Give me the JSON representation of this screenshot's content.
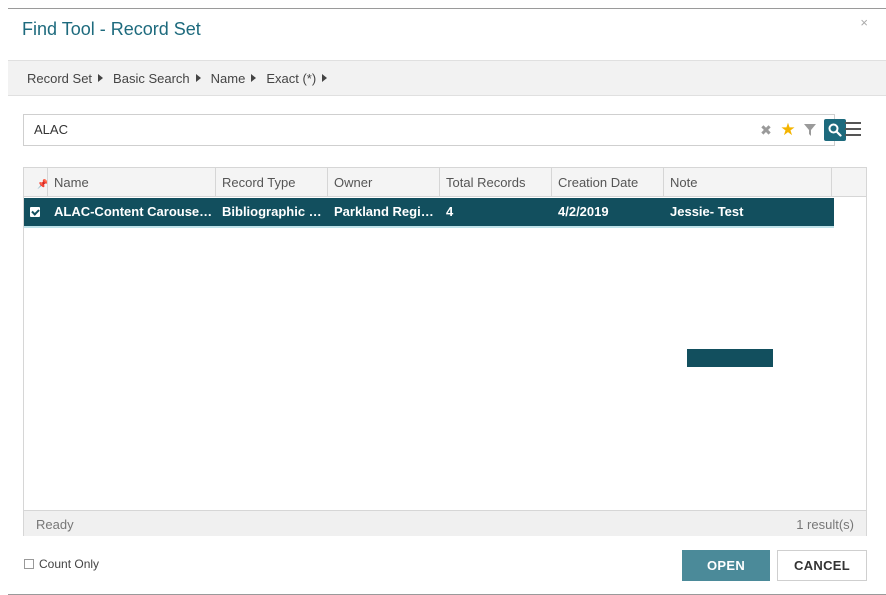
{
  "dialog": {
    "title": "Find Tool - Record Set",
    "close_glyph": "×"
  },
  "breadcrumb": [
    {
      "label": "Record Set"
    },
    {
      "label": "Basic Search"
    },
    {
      "label": "Name"
    },
    {
      "label": "Exact (*)"
    }
  ],
  "search": {
    "value": "ALAC",
    "icons": [
      "clear-icon",
      "star-icon",
      "filter-icon",
      "search-icon",
      "hamburger-menu-icon"
    ]
  },
  "grid": {
    "columns": [
      "Name",
      "Record Type",
      "Owner",
      "Total Records",
      "Creation Date",
      "Note"
    ],
    "rows": [
      {
        "selected": true,
        "name": "ALAC-Content Carousel-Bibliographic Records",
        "record_type": "Bibliographic Records",
        "owner": "Parkland Regional Library",
        "total_records": "4",
        "creation_date": "4/2/2019",
        "note": "Jessie- Test"
      }
    ],
    "status": "Ready",
    "result_count": "1 result(s)"
  },
  "footer": {
    "count_only_label": "Count Only",
    "open_label": "OPEN",
    "cancel_label": "CANCEL"
  },
  "colors": {
    "accent": "#1d6a7d",
    "selected_row": "#124f5e",
    "open_button": "#4b8a99",
    "star": "#f4b400"
  }
}
